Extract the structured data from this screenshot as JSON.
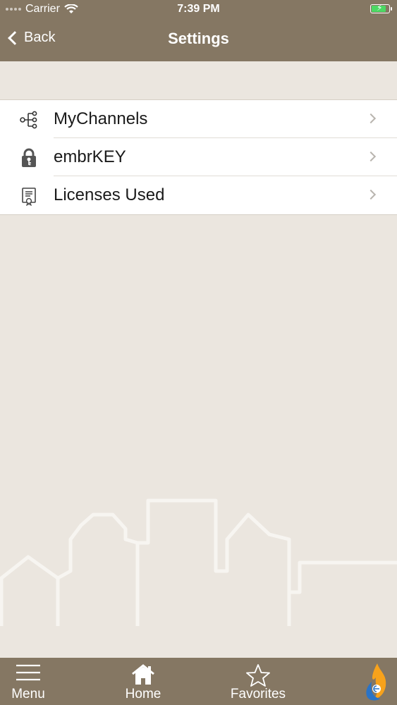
{
  "status_bar": {
    "carrier": "Carrier",
    "time": "7:39 PM"
  },
  "nav": {
    "back_label": "Back",
    "title": "Settings"
  },
  "settings_items": [
    {
      "label": "MyChannels",
      "icon": "channels-icon"
    },
    {
      "label": "embrKEY",
      "icon": "key-lock-icon"
    },
    {
      "label": "Licenses Used",
      "icon": "certificate-icon"
    }
  ],
  "tabs": [
    {
      "label": "Menu",
      "icon": "hamburger-icon"
    },
    {
      "label": "Home",
      "icon": "home-icon"
    },
    {
      "label": "Favorites",
      "icon": "star-icon"
    }
  ],
  "colors": {
    "bar": "#857763",
    "background": "#ebe6df",
    "accent_battery": "#4cd964"
  }
}
